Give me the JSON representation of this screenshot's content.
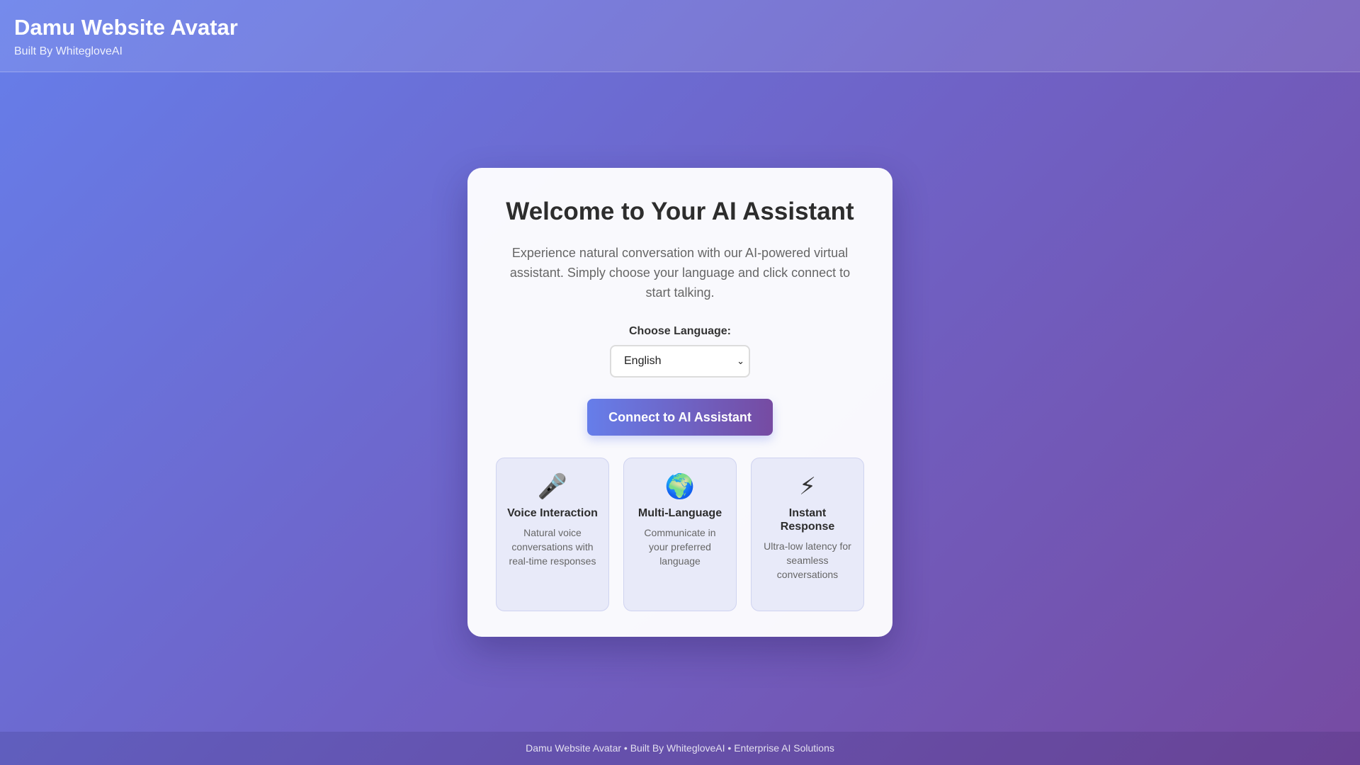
{
  "header": {
    "title": "Damu Website Avatar",
    "subtitle": "Built By WhitegloveAI"
  },
  "main": {
    "title": "Welcome to Your AI Assistant",
    "intro": "Experience natural conversation with our AI-powered virtual assistant. Simply choose your language and click connect to start talking.",
    "language_label": "Choose Language:",
    "language_selected": "English",
    "connect_label": "Connect to AI Assistant",
    "features": [
      {
        "icon": "microphone-icon",
        "glyph": "🎤",
        "title": "Voice Interaction",
        "desc": "Natural voice conversations with real-time responses"
      },
      {
        "icon": "globe-icon",
        "glyph": "🌍",
        "title": "Multi-Language",
        "desc": "Communicate in your preferred language"
      },
      {
        "icon": "lightning-icon",
        "glyph": "⚡",
        "title": "Instant Response",
        "desc": "Ultra-low latency for seamless conversations"
      }
    ]
  },
  "footer": {
    "text": "Damu Website Avatar • Built By WhitegloveAI • Enterprise AI Solutions"
  },
  "colors": {
    "gradient_start": "#667eea",
    "gradient_end": "#764ba2",
    "card_bg": "#ffffff",
    "feature_bg": "#e8eaf9"
  }
}
